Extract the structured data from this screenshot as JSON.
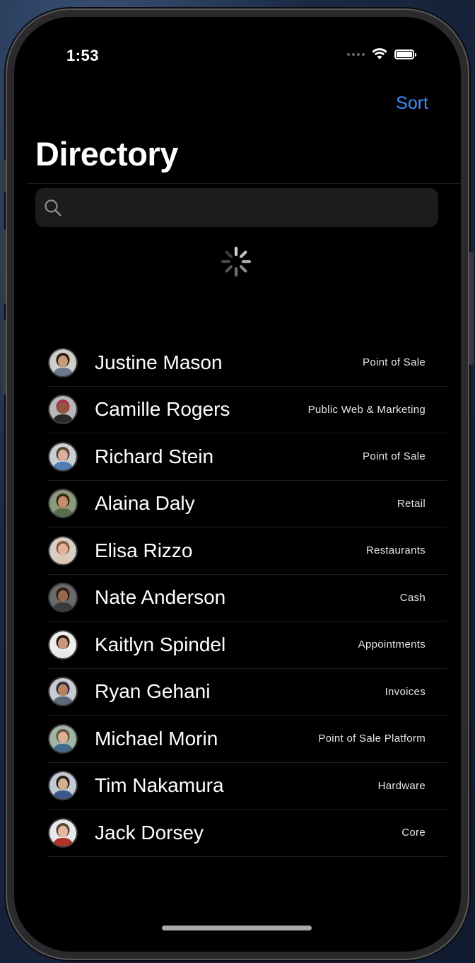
{
  "status_bar": {
    "time": "1:53"
  },
  "nav": {
    "sort_label": "Sort",
    "title": "Directory"
  },
  "search": {
    "placeholder": "",
    "value": ""
  },
  "people": [
    {
      "name": "Justine Mason",
      "team": "Point of Sale",
      "skin": "#c99a7a",
      "hair": "#2a1a12",
      "shirt": "#6a7a8a",
      "bg": "#cfcfc8"
    },
    {
      "name": "Camille Rogers",
      "team": "Public Web & Marketing",
      "skin": "#8a5a3e",
      "hair": "#b03050",
      "shirt": "#2a2a2a",
      "bg": "#b8b8b8"
    },
    {
      "name": "Richard Stein",
      "team": "Point of Sale",
      "skin": "#d9b09a",
      "hair": "#5a4030",
      "shirt": "#4f7fb0",
      "bg": "#c9d0d4"
    },
    {
      "name": "Alaina Daly",
      "team": "Retail",
      "skin": "#c48c6a",
      "hair": "#3a2418",
      "shirt": "#5b6c4a",
      "bg": "#8a9a7a"
    },
    {
      "name": "Elisa Rizzo",
      "team": "Restaurants",
      "skin": "#e0b49a",
      "hair": "#8a5a3a",
      "shirt": "#d9c8b8",
      "bg": "#d6cfc5"
    },
    {
      "name": "Nate Anderson",
      "team": "Cash",
      "skin": "#9a6a4e",
      "hair": "#2a1e18",
      "shirt": "#3a3a3a",
      "bg": "#6a6a6a"
    },
    {
      "name": "Kaitlyn Spindel",
      "team": "Appointments",
      "skin": "#c9987a",
      "hair": "#2a1a14",
      "shirt": "#e8e8e8",
      "bg": "#eeeeee"
    },
    {
      "name": "Ryan Gehani",
      "team": "Invoices",
      "skin": "#b3825e",
      "hair": "#2f2a40",
      "shirt": "#5a6a7a",
      "bg": "#c8ccd0"
    },
    {
      "name": "Michael Morin",
      "team": "Point of Sale Platform",
      "skin": "#dab094",
      "hair": "#6a5040",
      "shirt": "#3f6a8a",
      "bg": "#9fb5a6"
    },
    {
      "name": "Tim Nakamura",
      "team": "Hardware",
      "skin": "#d6b08e",
      "hair": "#1e1a16",
      "shirt": "#3b5a8a",
      "bg": "#c2cad4"
    },
    {
      "name": "Jack Dorsey",
      "team": "Core",
      "skin": "#e3b9a0",
      "hair": "#5a4636",
      "shirt": "#b0302a",
      "bg": "#e8e8e8"
    }
  ]
}
